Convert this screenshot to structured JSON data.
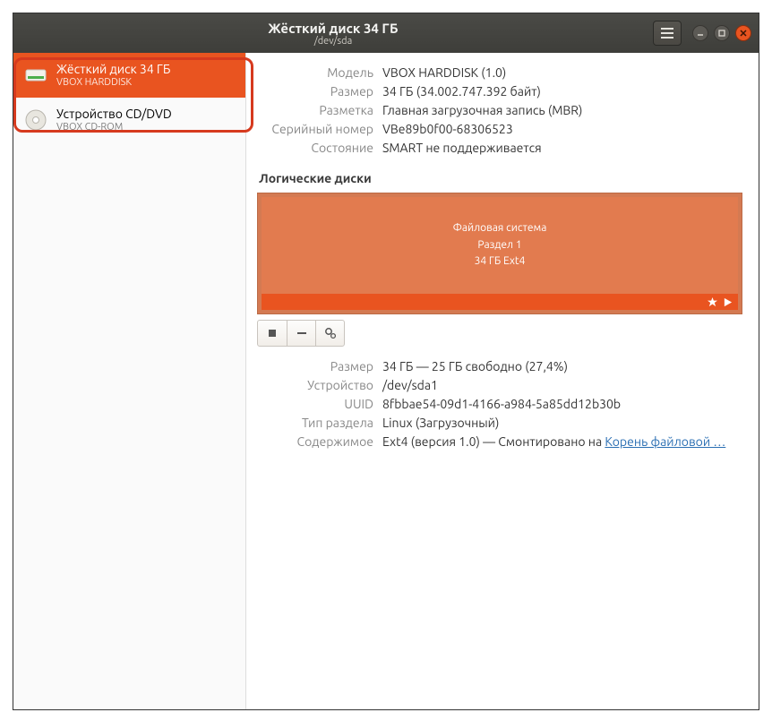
{
  "titlebar": {
    "title": "Жёсткий диск 34 ГБ",
    "subtitle": "/dev/sda"
  },
  "sidebar": {
    "items": [
      {
        "title": "Жёсткий диск 34 ГБ",
        "sub": "VBOX HARDDISK"
      },
      {
        "title": "Устройство CD/DVD",
        "sub": "VBOX CD-ROM"
      }
    ]
  },
  "overview": {
    "model_label": "Модель",
    "model_value": "VBOX HARDDISK (1.0)",
    "size_label": "Размер",
    "size_value": "34 ГБ (34.002.747.392 байт)",
    "part_label": "Разметка",
    "part_value": "Главная загрузочная запись (MBR)",
    "serial_label": "Серийный номер",
    "serial_value": "VBe89b0f00-68306523",
    "state_label": "Состояние",
    "state_value": "SMART не поддерживается"
  },
  "section_volumes": "Логические диски",
  "volume": {
    "line1": "Файловая система",
    "line2": "Раздел 1",
    "line3": "34 ГБ Ext4"
  },
  "details": {
    "size_label": "Размер",
    "size_value": "34 ГБ — 25 ГБ свободно (27,4%)",
    "device_label": "Устройство",
    "device_value": "/dev/sda1",
    "uuid_label": "UUID",
    "uuid_value": "8fbbae54-09d1-4166-a984-5a85dd12b30b",
    "type_label": "Тип раздела",
    "type_value": "Linux (Загрузочный)",
    "content_label": "Содержимое",
    "content_prefix": "Ext4 (версия 1.0) — Смонтировано на ",
    "content_link": "Корень файловой …"
  }
}
